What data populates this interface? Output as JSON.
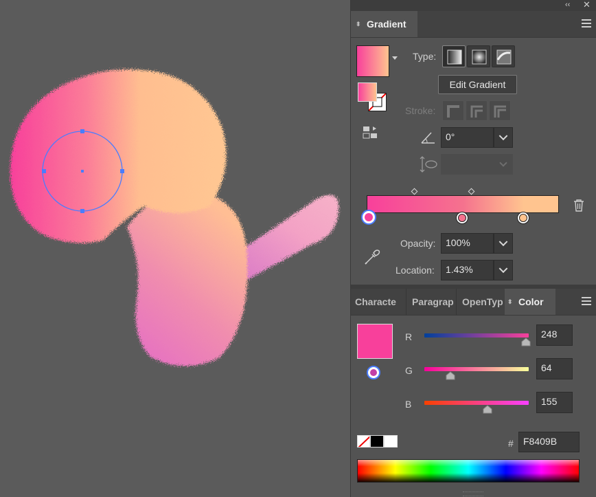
{
  "colors": {
    "canvas_bg": "#5b5b5b",
    "gradient_start": "#F8409B",
    "gradient_end": "#FFC48F",
    "selection_blue": "#4a7dff",
    "current_color": "#F8409B"
  },
  "top_bar": {
    "collapse_icon": "double-chevron-icon",
    "close_icon": "close-icon"
  },
  "gradient_panel": {
    "tab_label": "Gradient",
    "type_label": "Type:",
    "type_buttons": [
      "linear-gradient-icon",
      "radial-gradient-icon",
      "freeform-gradient-icon"
    ],
    "edit_button_label": "Edit Gradient",
    "stroke_label": "Stroke:",
    "angle_value": "0°",
    "opacity_label": "Opacity:",
    "opacity_value": "100%",
    "location_label": "Location:",
    "location_value": "1.43%",
    "stops": [
      {
        "location": 0.0143,
        "color": "#F8409B"
      },
      {
        "location": 0.5,
        "color": "#F5728E"
      },
      {
        "location": 0.82,
        "color": "#FFC48F"
      }
    ],
    "midpoints": [
      0.25,
      0.55
    ]
  },
  "color_panel": {
    "tabs": [
      "Characte",
      "Paragrap",
      "OpenTyp",
      "Color"
    ],
    "active_tab": "Color",
    "r_label": "R",
    "r_value": "248",
    "g_label": "G",
    "g_value": "64",
    "b_label": "B",
    "b_value": "155",
    "r_level": 0.973,
    "g_level": 0.251,
    "b_level": 0.608,
    "hash_label": "#",
    "hex_value": "F8409B"
  }
}
